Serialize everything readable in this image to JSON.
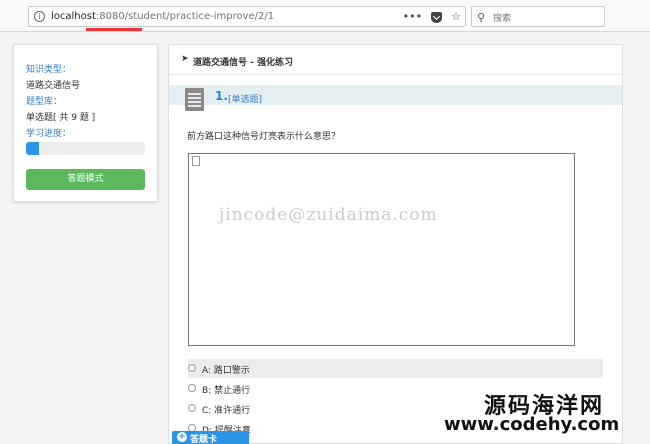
{
  "browser": {
    "url_host": "localhost",
    "url_path": ":8080/student/practice-improve/2/1",
    "more_glyph": "•••",
    "star_glyph": "☆",
    "search_placeholder": "搜索"
  },
  "sidebar": {
    "knowledge_type_label": "知识类型：",
    "knowledge_type_value": "道路交通信号",
    "question_bank_label": "题型库：",
    "question_bank_value": "单选题[ 共 9 题 ]",
    "progress_label": "学习进度：",
    "progress_fraction": 0.11,
    "mode_button": "答题模式"
  },
  "main": {
    "panel_title": "道路交通信号 - 强化练习",
    "question_number": "1.",
    "question_type": "[单选题]",
    "question_text": "前方路口这种信号灯亮表示什么意思？",
    "watermark": "jincode@zuidaima.com",
    "options": [
      {
        "label": "A: 路口警示",
        "selected": true
      },
      {
        "label": "B: 禁止通行",
        "selected": false
      },
      {
        "label": "C: 准许通行",
        "selected": false
      },
      {
        "label": "D: 提醒注意",
        "selected": false
      }
    ],
    "answer_card_button": "答题卡"
  },
  "site_mark": {
    "name": "源码海洋网",
    "url": "www.codehy.com"
  },
  "colors": {
    "accent_blue": "#2a95e4",
    "green_button": "#5cb85c",
    "label_blue": "#3a7bc8"
  }
}
